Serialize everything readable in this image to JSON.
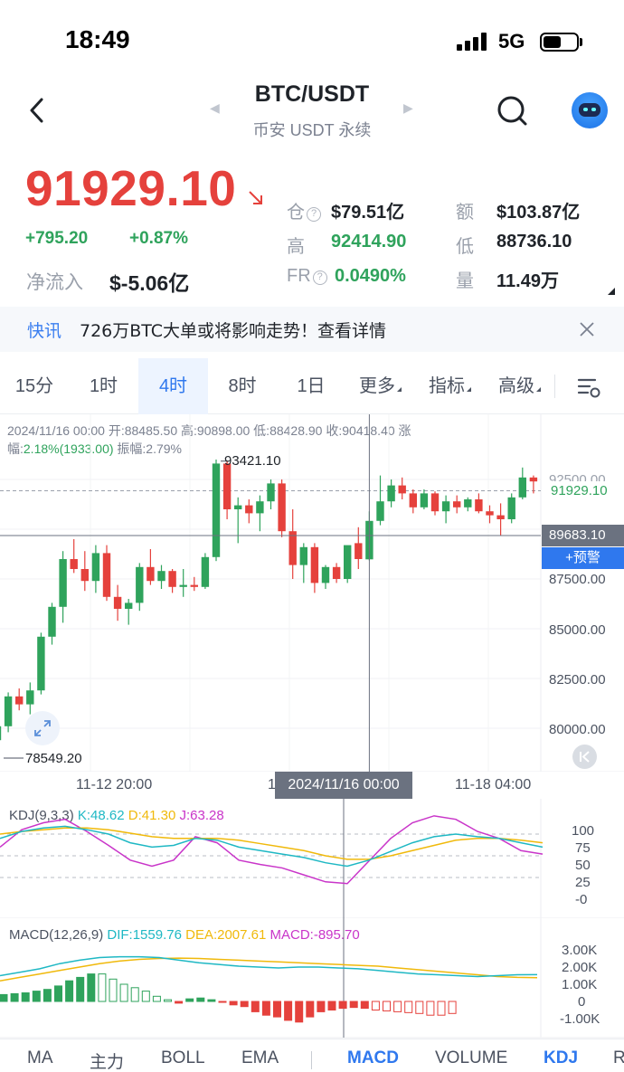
{
  "status": {
    "time": "18:49",
    "network": "5G",
    "battery_level": 0.55
  },
  "header": {
    "title": "BTC/USDT",
    "subtitle": "币安 USDT 永续"
  },
  "ticker": {
    "price": "91929.10",
    "change": "+795.20",
    "change_pct": "+0.87%",
    "netflow_label": "净流入",
    "netflow_value": "$-5.06亿",
    "stats": [
      {
        "label": "仓",
        "value": "$79.51亿",
        "help": true
      },
      {
        "label": "额",
        "value": "$103.87亿"
      },
      {
        "label": "高",
        "value": "92414.90",
        "green": true
      },
      {
        "label": "低",
        "value": "88736.10"
      },
      {
        "label": "FR",
        "value": "0.0490%",
        "help": true,
        "green": true
      },
      {
        "label": "量",
        "value": "11.49万"
      }
    ]
  },
  "news": {
    "tag": "快讯",
    "text": "726万BTC大单或将影响走势！查看详情"
  },
  "timeframes": [
    {
      "label": "15分"
    },
    {
      "label": "1时"
    },
    {
      "label": "4时",
      "active": true
    },
    {
      "label": "8时"
    },
    {
      "label": "1日"
    },
    {
      "label": "更多",
      "dropdown": true
    },
    {
      "label": "指标",
      "dropdown": true
    },
    {
      "label": "高级",
      "dropdown": true
    }
  ],
  "candle_info": {
    "line1": "2024/11/16 00:00 开:88485.50 高:90898.00 低:88428.90 收:90418.40 涨",
    "line2_prefix": "幅:",
    "line2_change": "2.18%(1933.00)",
    "line2_suffix": " 振幅:2.79%"
  },
  "chart": {
    "y_ticks": [
      "92500.00",
      "87500.00",
      "85000.00",
      "82500.00",
      "80000.00"
    ],
    "current_price_tag": "91929.10",
    "crosshair_price_tag": "89683.10",
    "alert_label": "+预警",
    "high_marker": "93421.10",
    "low_marker": "78549.20",
    "x_labels": [
      "11-12 20:00",
      "11-18 04:00"
    ],
    "crosshair_time": "2024/11/16 00:00",
    "accent_up": "#2fa35c",
    "accent_down": "#e5413c"
  },
  "chart_data": {
    "type": "candlestick",
    "interval": "4h",
    "ylim": [
      78000,
      94500
    ],
    "candles": [
      [
        79400,
        80600,
        79000,
        80100
      ],
      [
        80100,
        81800,
        79800,
        81600
      ],
      [
        81600,
        82000,
        80900,
        81200
      ],
      [
        81200,
        82300,
        80700,
        81900
      ],
      [
        81900,
        84800,
        81700,
        84600
      ],
      [
        84600,
        86300,
        84200,
        86100
      ],
      [
        86100,
        88900,
        85300,
        88500
      ],
      [
        88500,
        89500,
        87800,
        88000
      ],
      [
        88000,
        88900,
        86900,
        87400
      ],
      [
        87400,
        89200,
        86800,
        88800
      ],
      [
        88800,
        89200,
        86400,
        86600
      ],
      [
        86600,
        87200,
        85400,
        86000
      ],
      [
        86000,
        86500,
        85200,
        86300
      ],
      [
        86300,
        88300,
        85900,
        88100
      ],
      [
        88100,
        89000,
        87200,
        87400
      ],
      [
        87400,
        88200,
        87000,
        87900
      ],
      [
        87900,
        88000,
        86800,
        87100
      ],
      [
        87100,
        88000,
        86600,
        87200
      ],
      [
        87200,
        87600,
        86900,
        87100
      ],
      [
        87100,
        88800,
        87000,
        88600
      ],
      [
        88600,
        93500,
        88400,
        93300
      ],
      [
        93300,
        93421.1,
        90500,
        91000
      ],
      [
        91000,
        91600,
        89300,
        91200
      ],
      [
        91200,
        91500,
        90300,
        90800
      ],
      [
        90800,
        91700,
        89900,
        91400
      ],
      [
        91400,
        92500,
        91000,
        92300
      ],
      [
        92300,
        92500,
        89600,
        89900
      ],
      [
        89900,
        91000,
        87500,
        88200
      ],
      [
        88200,
        89300,
        87300,
        89100
      ],
      [
        89100,
        89300,
        86800,
        87300
      ],
      [
        87300,
        88200,
        87000,
        88100
      ],
      [
        88100,
        88300,
        87300,
        87500
      ],
      [
        87500,
        89000,
        87300,
        89200
      ],
      [
        89300,
        90100,
        88000,
        88500
      ],
      [
        88485.5,
        90898,
        88428.9,
        90418.4
      ],
      [
        90418.4,
        92700,
        90200,
        91400
      ],
      [
        91400,
        92500,
        91100,
        92200
      ],
      [
        92200,
        92600,
        91500,
        91800
      ],
      [
        91800,
        92000,
        90800,
        91100
      ],
      [
        91100,
        92000,
        91000,
        91800
      ],
      [
        91800,
        91900,
        90700,
        90900
      ],
      [
        90900,
        91700,
        90300,
        91400
      ],
      [
        91400,
        91700,
        90800,
        91100
      ],
      [
        91100,
        91600,
        90900,
        91500
      ],
      [
        91500,
        91800,
        90800,
        90900
      ],
      [
        90900,
        91200,
        90300,
        90700
      ],
      [
        90700,
        91300,
        89700,
        90500
      ],
      [
        90500,
        91800,
        90300,
        91600
      ],
      [
        91600,
        93100,
        91500,
        92600
      ],
      [
        92600,
        92700,
        91800,
        92400
      ]
    ]
  },
  "kdj": {
    "title": "KDJ(9,3,3)",
    "k": "K:48.62",
    "d": "D:41.30",
    "j": "J:63.28",
    "axis": [
      "100",
      "75",
      "50",
      "25",
      "-0"
    ],
    "k_color": "#1fb8c4",
    "d_color": "#f0b90b",
    "j_color": "#c935c9"
  },
  "macd": {
    "title": "MACD(12,26,9)",
    "dif": "DIF:1559.76",
    "dea": "DEA:2007.61",
    "macd": "MACD:-895.70",
    "axis": [
      "3.00K",
      "2.00K",
      "1.00K",
      "0",
      "-1.00K"
    ],
    "dif_color": "#1fb8c4",
    "dea_color": "#f0b90b",
    "macd_color": "#c935c9"
  },
  "bottom_tabs": [
    {
      "label": "MA"
    },
    {
      "label": "主力"
    },
    {
      "label": "BOLL"
    },
    {
      "label": "EMA"
    },
    {
      "label": "MACD",
      "active": true
    },
    {
      "label": "VOLUME"
    },
    {
      "label": "KDJ",
      "active": true
    },
    {
      "label": "R"
    }
  ]
}
